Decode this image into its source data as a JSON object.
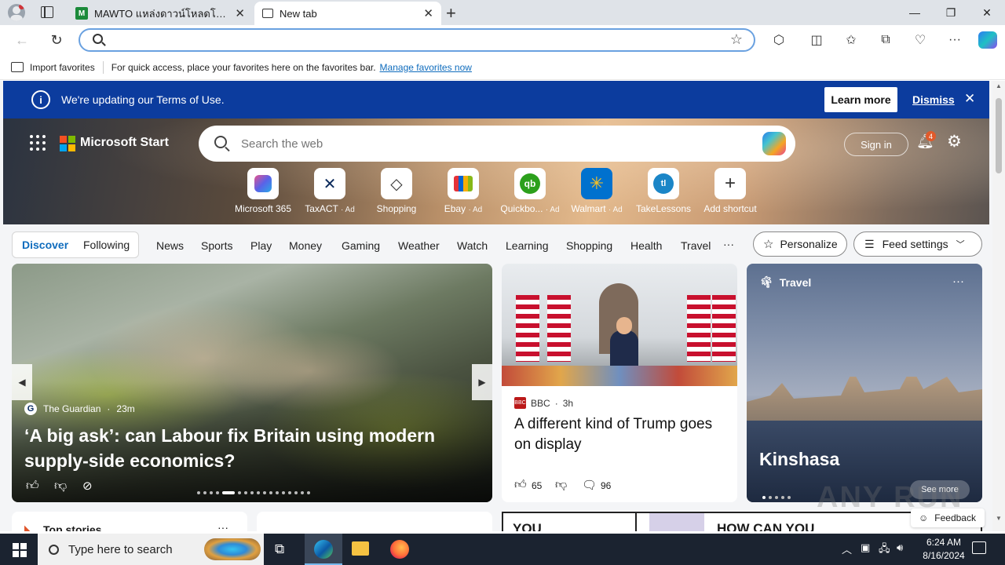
{
  "browser": {
    "tabs": [
      {
        "title": "MAWTO แหล่งดาวน์โหลดโปรแกรมฟรี",
        "active": false
      },
      {
        "title": "New tab",
        "active": true
      }
    ],
    "address_value": "",
    "favorites_bar": {
      "import_label": "Import favorites",
      "hint": "For quick access, place your favorites here on the favorites bar.",
      "manage_link": "Manage favorites now"
    }
  },
  "banner": {
    "message": "We're updating our Terms of Use.",
    "learn_more": "Learn more",
    "dismiss": "Dismiss"
  },
  "header": {
    "brand": "Microsoft Start",
    "search_placeholder": "Search the web",
    "sign_in": "Sign in",
    "notification_count": "4"
  },
  "quick_links": [
    {
      "label": "Microsoft 365",
      "ad": "",
      "icon": "microsoft-365-icon"
    },
    {
      "label": "TaxACT",
      "ad": "· Ad",
      "icon": "taxact-icon"
    },
    {
      "label": "Shopping",
      "ad": "",
      "icon": "shopping-tag-icon"
    },
    {
      "label": "Ebay",
      "ad": "· Ad",
      "icon": "ebay-bag-icon"
    },
    {
      "label": "Quickbo...",
      "ad": "· Ad",
      "icon": "quickbooks-icon"
    },
    {
      "label": "Walmart",
      "ad": "· Ad",
      "icon": "walmart-icon"
    },
    {
      "label": "TakeLessons",
      "ad": "",
      "icon": "takelessons-icon"
    },
    {
      "label": "Add shortcut",
      "ad": "",
      "icon": "plus-icon"
    }
  ],
  "nav": {
    "discover": "Discover",
    "following": "Following",
    "items": [
      "News",
      "Sports",
      "Play",
      "Money",
      "Gaming",
      "Weather",
      "Watch",
      "Learning",
      "Shopping",
      "Health",
      "Travel"
    ],
    "more": "···",
    "personalize": "Personalize",
    "feed_settings": "Feed settings"
  },
  "main_story": {
    "source": "The Guardian",
    "age": "23m",
    "headline": "‘A big ask’: can Labour fix Britain using modern supply-side economics?"
  },
  "second_story": {
    "source": "BBC",
    "age": "3h",
    "headline": "A different kind of Trump goes on display",
    "likes": "65",
    "comments": "96"
  },
  "travel_card": {
    "category": "Travel",
    "city": "Kinshasa",
    "see_more": "See more"
  },
  "lower": {
    "top_stories": "Top stories",
    "comic_text_1": "YOU",
    "comic_text_2": "HOW CAN YOU",
    "feedback": "Feedback"
  },
  "watermark": "ANY RUN",
  "taskbar": {
    "search_placeholder": "Type here to search",
    "time": "6:24 AM",
    "date": "8/16/2024"
  },
  "colors": {
    "banner_bg": "#0c3c9e",
    "accent": "#0f6cbd",
    "taskbar_bg": "#1b2330"
  }
}
